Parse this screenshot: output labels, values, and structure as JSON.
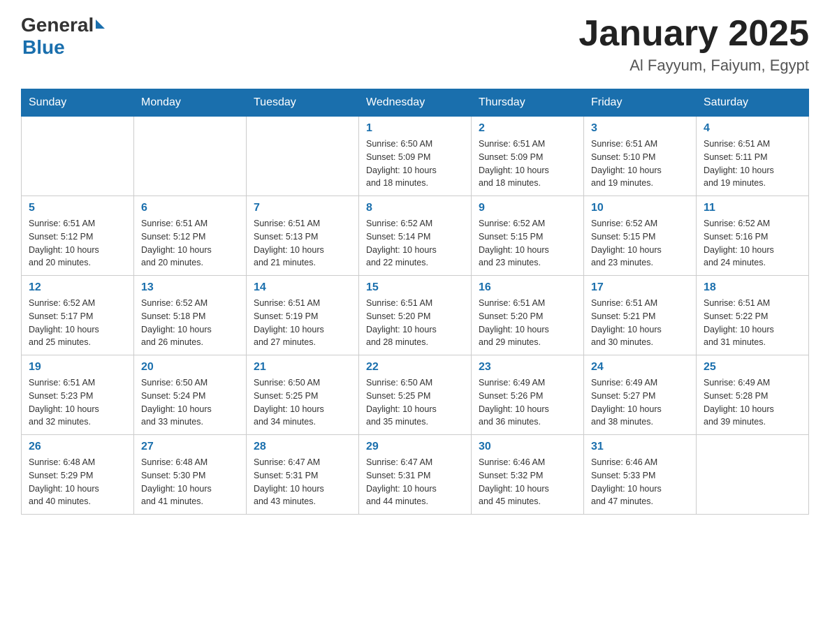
{
  "header": {
    "month_title": "January 2025",
    "location": "Al Fayyum, Faiyum, Egypt",
    "logo_general": "General",
    "logo_blue": "Blue"
  },
  "days_of_week": [
    "Sunday",
    "Monday",
    "Tuesday",
    "Wednesday",
    "Thursday",
    "Friday",
    "Saturday"
  ],
  "weeks": [
    [
      {
        "day": "",
        "info": ""
      },
      {
        "day": "",
        "info": ""
      },
      {
        "day": "",
        "info": ""
      },
      {
        "day": "1",
        "info": "Sunrise: 6:50 AM\nSunset: 5:09 PM\nDaylight: 10 hours\nand 18 minutes."
      },
      {
        "day": "2",
        "info": "Sunrise: 6:51 AM\nSunset: 5:09 PM\nDaylight: 10 hours\nand 18 minutes."
      },
      {
        "day": "3",
        "info": "Sunrise: 6:51 AM\nSunset: 5:10 PM\nDaylight: 10 hours\nand 19 minutes."
      },
      {
        "day": "4",
        "info": "Sunrise: 6:51 AM\nSunset: 5:11 PM\nDaylight: 10 hours\nand 19 minutes."
      }
    ],
    [
      {
        "day": "5",
        "info": "Sunrise: 6:51 AM\nSunset: 5:12 PM\nDaylight: 10 hours\nand 20 minutes."
      },
      {
        "day": "6",
        "info": "Sunrise: 6:51 AM\nSunset: 5:12 PM\nDaylight: 10 hours\nand 20 minutes."
      },
      {
        "day": "7",
        "info": "Sunrise: 6:51 AM\nSunset: 5:13 PM\nDaylight: 10 hours\nand 21 minutes."
      },
      {
        "day": "8",
        "info": "Sunrise: 6:52 AM\nSunset: 5:14 PM\nDaylight: 10 hours\nand 22 minutes."
      },
      {
        "day": "9",
        "info": "Sunrise: 6:52 AM\nSunset: 5:15 PM\nDaylight: 10 hours\nand 23 minutes."
      },
      {
        "day": "10",
        "info": "Sunrise: 6:52 AM\nSunset: 5:15 PM\nDaylight: 10 hours\nand 23 minutes."
      },
      {
        "day": "11",
        "info": "Sunrise: 6:52 AM\nSunset: 5:16 PM\nDaylight: 10 hours\nand 24 minutes."
      }
    ],
    [
      {
        "day": "12",
        "info": "Sunrise: 6:52 AM\nSunset: 5:17 PM\nDaylight: 10 hours\nand 25 minutes."
      },
      {
        "day": "13",
        "info": "Sunrise: 6:52 AM\nSunset: 5:18 PM\nDaylight: 10 hours\nand 26 minutes."
      },
      {
        "day": "14",
        "info": "Sunrise: 6:51 AM\nSunset: 5:19 PM\nDaylight: 10 hours\nand 27 minutes."
      },
      {
        "day": "15",
        "info": "Sunrise: 6:51 AM\nSunset: 5:20 PM\nDaylight: 10 hours\nand 28 minutes."
      },
      {
        "day": "16",
        "info": "Sunrise: 6:51 AM\nSunset: 5:20 PM\nDaylight: 10 hours\nand 29 minutes."
      },
      {
        "day": "17",
        "info": "Sunrise: 6:51 AM\nSunset: 5:21 PM\nDaylight: 10 hours\nand 30 minutes."
      },
      {
        "day": "18",
        "info": "Sunrise: 6:51 AM\nSunset: 5:22 PM\nDaylight: 10 hours\nand 31 minutes."
      }
    ],
    [
      {
        "day": "19",
        "info": "Sunrise: 6:51 AM\nSunset: 5:23 PM\nDaylight: 10 hours\nand 32 minutes."
      },
      {
        "day": "20",
        "info": "Sunrise: 6:50 AM\nSunset: 5:24 PM\nDaylight: 10 hours\nand 33 minutes."
      },
      {
        "day": "21",
        "info": "Sunrise: 6:50 AM\nSunset: 5:25 PM\nDaylight: 10 hours\nand 34 minutes."
      },
      {
        "day": "22",
        "info": "Sunrise: 6:50 AM\nSunset: 5:25 PM\nDaylight: 10 hours\nand 35 minutes."
      },
      {
        "day": "23",
        "info": "Sunrise: 6:49 AM\nSunset: 5:26 PM\nDaylight: 10 hours\nand 36 minutes."
      },
      {
        "day": "24",
        "info": "Sunrise: 6:49 AM\nSunset: 5:27 PM\nDaylight: 10 hours\nand 38 minutes."
      },
      {
        "day": "25",
        "info": "Sunrise: 6:49 AM\nSunset: 5:28 PM\nDaylight: 10 hours\nand 39 minutes."
      }
    ],
    [
      {
        "day": "26",
        "info": "Sunrise: 6:48 AM\nSunset: 5:29 PM\nDaylight: 10 hours\nand 40 minutes."
      },
      {
        "day": "27",
        "info": "Sunrise: 6:48 AM\nSunset: 5:30 PM\nDaylight: 10 hours\nand 41 minutes."
      },
      {
        "day": "28",
        "info": "Sunrise: 6:47 AM\nSunset: 5:31 PM\nDaylight: 10 hours\nand 43 minutes."
      },
      {
        "day": "29",
        "info": "Sunrise: 6:47 AM\nSunset: 5:31 PM\nDaylight: 10 hours\nand 44 minutes."
      },
      {
        "day": "30",
        "info": "Sunrise: 6:46 AM\nSunset: 5:32 PM\nDaylight: 10 hours\nand 45 minutes."
      },
      {
        "day": "31",
        "info": "Sunrise: 6:46 AM\nSunset: 5:33 PM\nDaylight: 10 hours\nand 47 minutes."
      },
      {
        "day": "",
        "info": ""
      }
    ]
  ]
}
